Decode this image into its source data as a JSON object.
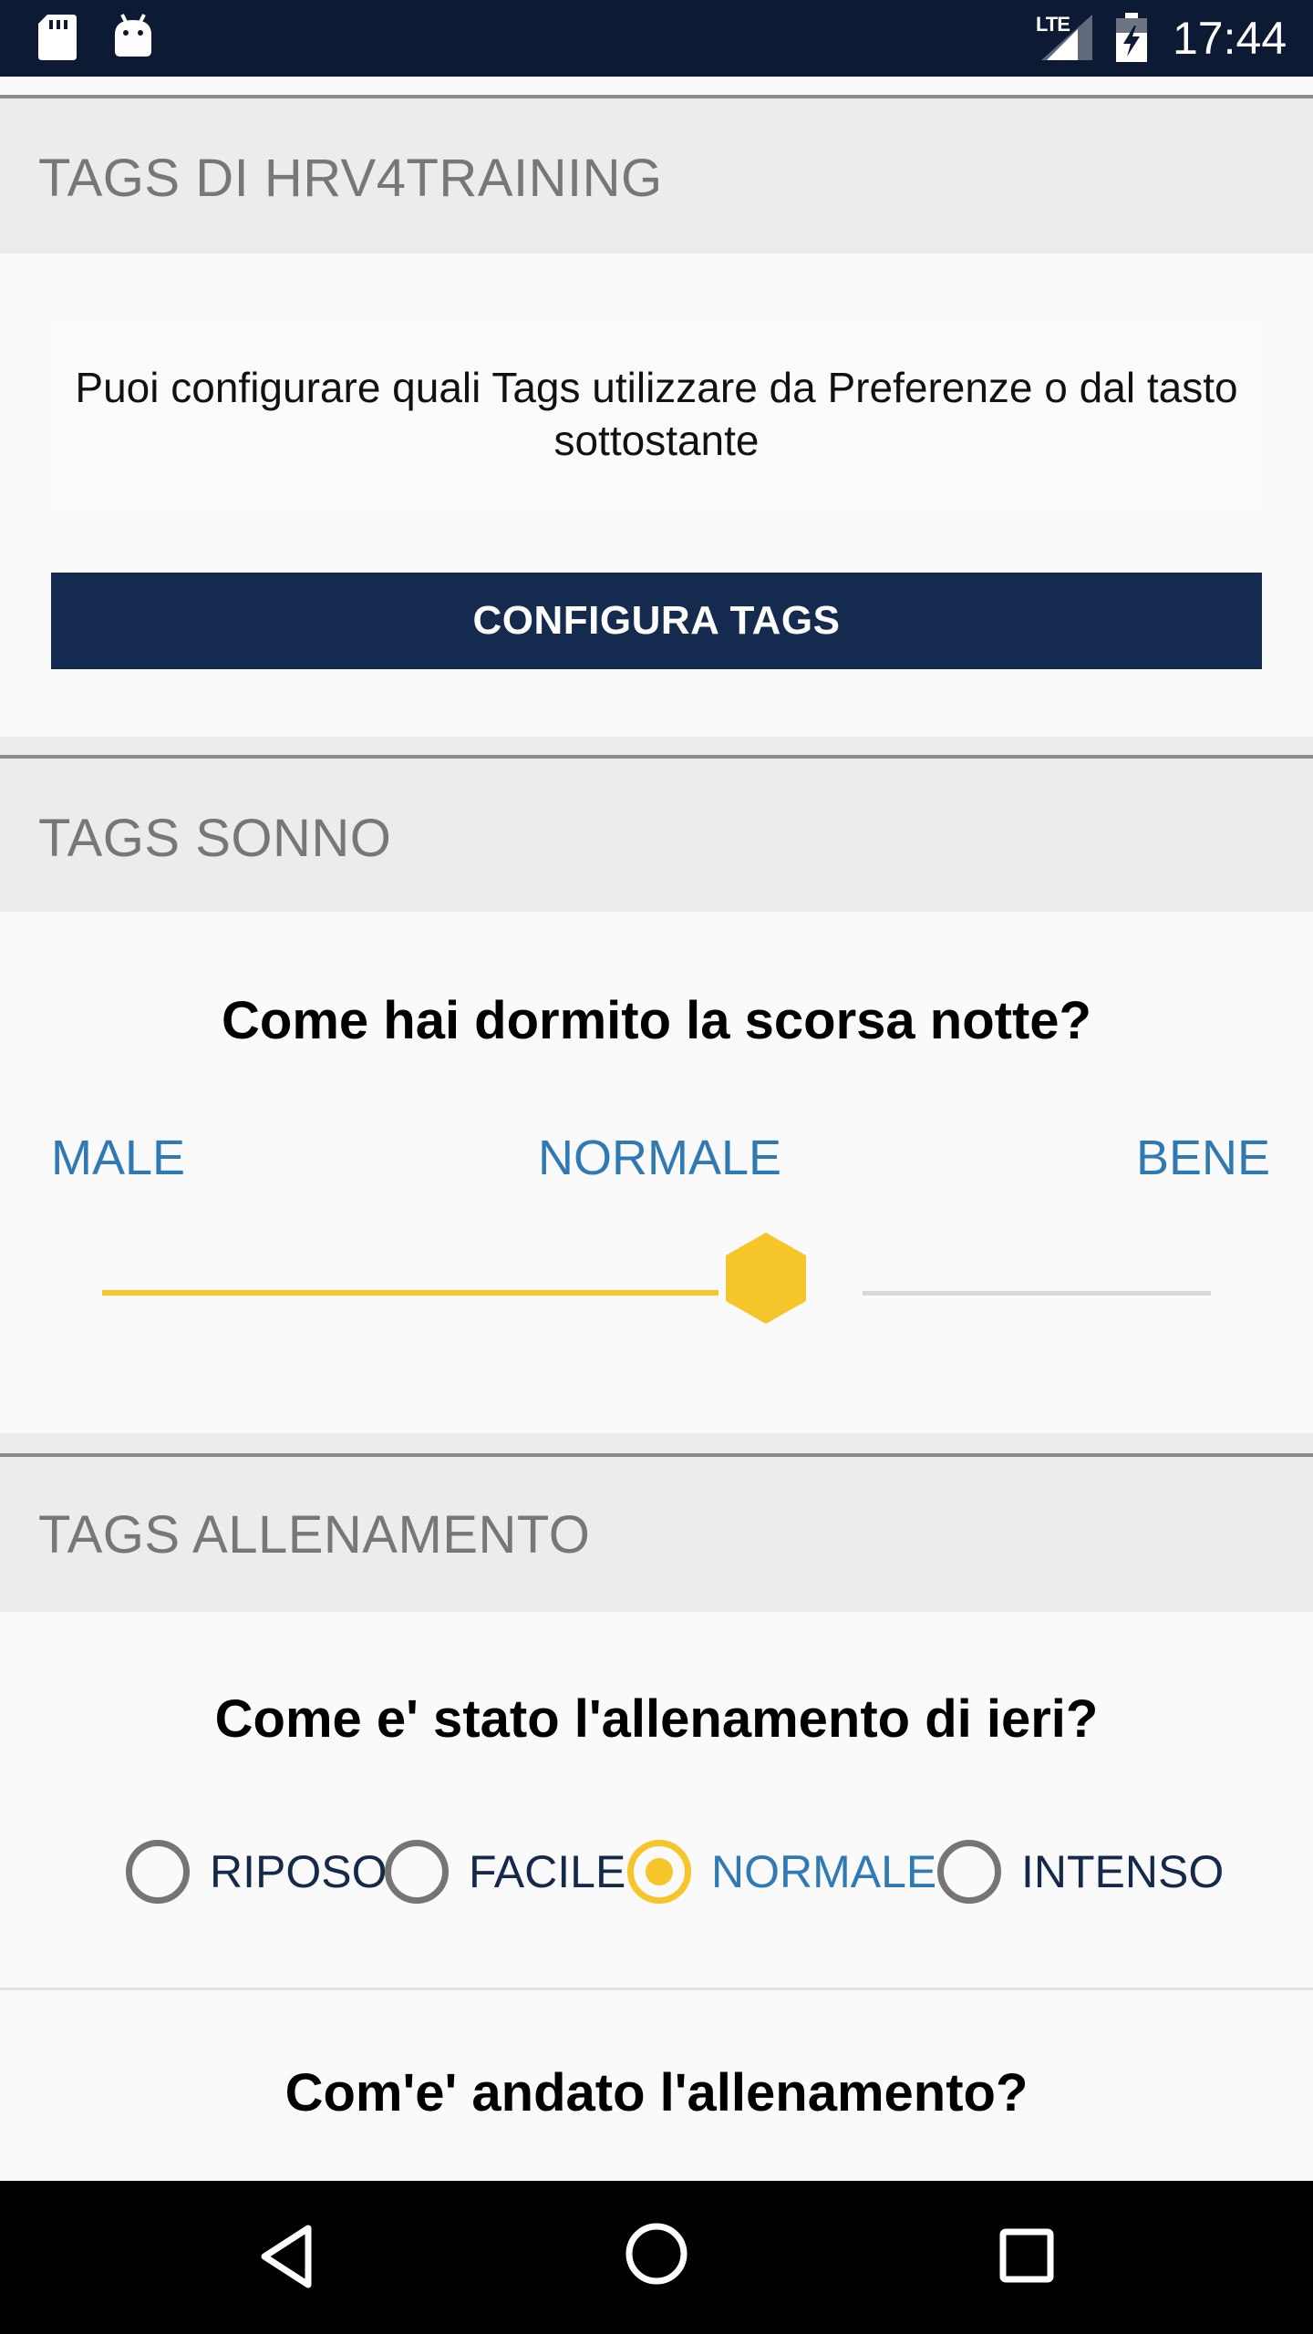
{
  "status_bar": {
    "network": "LTE",
    "time": "17:44",
    "icons": [
      "sd-card-icon",
      "android-debug-icon",
      "signal-icon",
      "battery-charging-icon"
    ]
  },
  "sections": {
    "hrv": {
      "header": "TAGS DI HRV4TRAINING",
      "info_text": "Puoi configurare quali Tags utilizzare da Preferenze o dal tasto sottostante",
      "button_label": "CONFIGURA TAGS"
    },
    "sleep": {
      "header": "TAGS SONNO",
      "question": "Come hai dormito la scorsa notte?",
      "labels": {
        "low": "MALE",
        "mid": "NORMALE",
        "high": "BENE"
      },
      "slider_value": 0.5
    },
    "training": {
      "header": "TAGS ALLENAMENTO",
      "question": "Come e' stato l'allenamento di ieri?",
      "options": [
        "RIPOSO",
        "FACILE",
        "NORMALE",
        "INTENSO"
      ],
      "selected_option": "NORMALE",
      "question2": "Com'e' andato l'allenamento?"
    }
  },
  "colors": {
    "accent": "#f5c52a",
    "primary": "#142a4f",
    "link": "#2f7ab5",
    "status_bar": "#0d1a33"
  },
  "nav_bar": {
    "icons": [
      "back-icon",
      "home-icon",
      "recents-icon"
    ]
  }
}
